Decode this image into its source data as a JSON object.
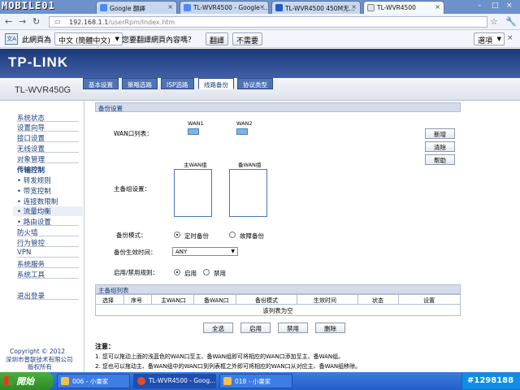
{
  "watermark": {
    "logo": "MOBILE01"
  },
  "browser": {
    "tabs": [
      {
        "label": "Google 翻譯",
        "color": "#4c8bf5"
      },
      {
        "label": "TL-WVR4500 - Google ...",
        "color": "#4c8bf5"
      },
      {
        "label": "TL-WVR4500 450M无...",
        "color": "#1c5bc8"
      },
      {
        "label": "TL-WVR4500",
        "color": "#1c5bc8"
      }
    ],
    "url_host": "192.168.1.1",
    "url_path": "/userRpm/Index.htm",
    "minimize": "–",
    "maximize": "□",
    "close": "×"
  },
  "translate_bar": {
    "prefix": "此網頁為",
    "language": "中文 (簡體中文)",
    "question": "您要翻譯網頁內容嗎？",
    "translate_btn": "翻譯",
    "no_btn": "不需要",
    "options_btn": "選項"
  },
  "router": {
    "brand": "TP-LINK",
    "model": "TL-WVR450G",
    "menu_tabs": [
      "基本设置",
      "策略选路",
      "ISP选路",
      "线路备份",
      "协议类型"
    ],
    "active_tab_index": 3
  },
  "sidebar": {
    "items": [
      {
        "label": "系统状态",
        "type": "top"
      },
      {
        "label": "设置向导",
        "type": "top"
      },
      {
        "label": "接口设置",
        "type": "top"
      },
      {
        "label": "无线设置",
        "type": "top"
      },
      {
        "label": "对象管理",
        "type": "top"
      },
      {
        "label": "传输控制",
        "type": "bold"
      },
      {
        "label": "• 转发规则",
        "type": "sub"
      },
      {
        "label": "• 带宽控制",
        "type": "sub"
      },
      {
        "label": "• 连接数限制",
        "type": "sub"
      },
      {
        "label": "• 流量均衡",
        "type": "selected"
      },
      {
        "label": "• 路由设置",
        "type": "sub"
      },
      {
        "label": "防火墙",
        "type": "top"
      },
      {
        "label": "行为管控",
        "type": "top"
      },
      {
        "label": "VPN",
        "type": "top"
      },
      {
        "label": "系统服务",
        "type": "top"
      },
      {
        "label": "系统工具",
        "type": "top"
      },
      {
        "label": "退出登录",
        "type": "top"
      }
    ],
    "copyright_line1": "Copyright © 2012",
    "copyright_line2": "深圳市普联技术有限公司",
    "copyright_line3": "版权所有"
  },
  "backup_settings": {
    "section_title": "备份设置",
    "wan_list_label": "WAN口列表：",
    "wan_ports": [
      "WAN1",
      "WAN2"
    ],
    "primary_group_label": "主WAN组",
    "backup_group_label": "备WAN组",
    "group_setting_label": "主备组设置：",
    "mode_label": "备份模式：",
    "mode_options": [
      "定时备份",
      "故障备份"
    ],
    "mode_selected": 0,
    "time_label": "备份生效时间：",
    "time_value": "ANY",
    "enable_label": "启用/禁用规则：",
    "enable_options": [
      "启用",
      "禁用"
    ],
    "enable_selected": 0,
    "buttons": [
      "新增",
      "清除",
      "帮助"
    ]
  },
  "group_list": {
    "section_title": "主备组列表",
    "columns": [
      "选择",
      "序号",
      "主WAN口",
      "备WAN口",
      "备份模式",
      "生效时间",
      "状态",
      "设置"
    ],
    "empty_text": "该列表为空",
    "actions": [
      "全选",
      "启用",
      "禁用",
      "删除"
    ]
  },
  "notes": {
    "title": "注意：",
    "lines": [
      "1. 您可以拖动上面的浅蓝色的WAN口至主、备WAN组即可将相应的WAN口添加至主、备WAN组。",
      "2. 您也可以拖动主、备WAN组中的WAN口到列表框之外即可将相应的WAN口从对应主、备WAN组移除。"
    ]
  },
  "taskbar": {
    "start_label": "開始",
    "tasks": [
      "006 - 小畫家",
      "TL-WVR4500 - Goog...",
      "018 - 小畫家"
    ],
    "tray_text": "#1298188"
  }
}
